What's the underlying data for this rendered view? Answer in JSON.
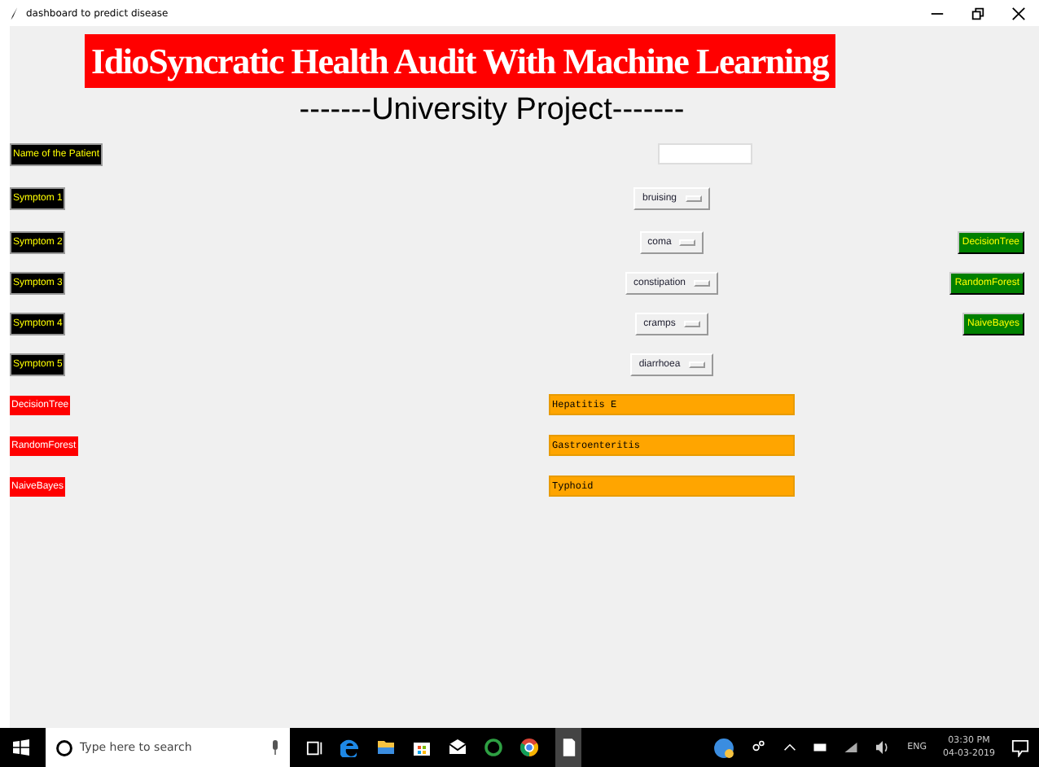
{
  "window": {
    "title": "dashboard to predict disease"
  },
  "heading": "IdioSyncratic Health Audit With Machine Learning",
  "subheading": "-------University Project-------",
  "patient": {
    "label": "Name of the Patient"
  },
  "symptoms": [
    {
      "label": "Symptom 1",
      "value": "bruising"
    },
    {
      "label": "Symptom 2",
      "value": "coma"
    },
    {
      "label": "Symptom 3",
      "value": "constipation"
    },
    {
      "label": "Symptom 4",
      "value": "cramps"
    },
    {
      "label": "Symptom 5",
      "value": "diarrhoea"
    }
  ],
  "results": [
    {
      "label": "DecisionTree",
      "value": "Hepatitis E"
    },
    {
      "label": "RandomForest",
      "value": "Gastroenteritis"
    },
    {
      "label": "NaiveBayes",
      "value": "Typhoid"
    }
  ],
  "buttons": [
    "DecisionTree",
    "RandomForest",
    "NaiveBayes"
  ],
  "taskbar": {
    "search_placeholder": "Type here to search",
    "language": "ENG",
    "time": "03:30 PM",
    "date": "04-03-2019"
  }
}
